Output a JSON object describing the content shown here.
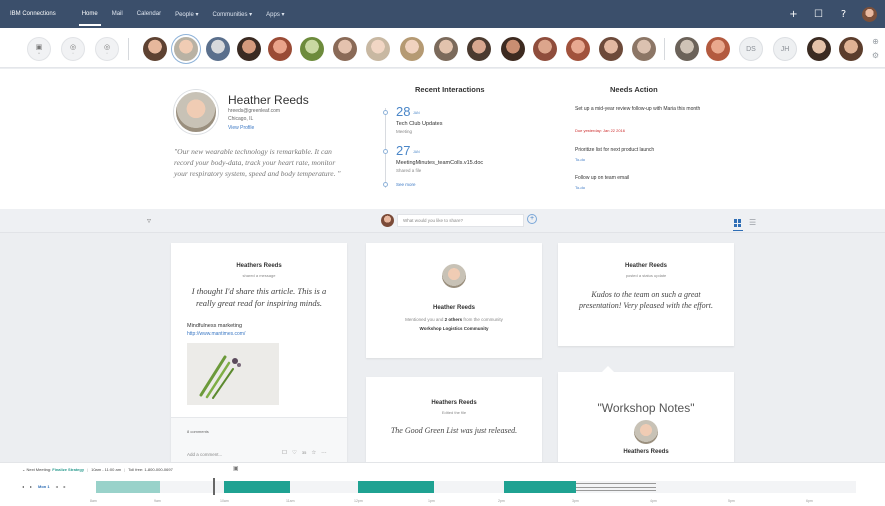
{
  "topnav": {
    "brand": "IBM Connections",
    "items": [
      "Home",
      "Mail",
      "Calendar",
      "People ▾",
      "Communities ▾",
      "Apps ▾"
    ],
    "active": "Home"
  },
  "strip": {
    "utility": [
      {
        "icon": "calendar-icon",
        "glyph": "▣",
        "caption": "••"
      },
      {
        "icon": "bell-icon",
        "glyph": "◎",
        "caption": "•"
      },
      {
        "icon": "pin-icon",
        "glyph": "◎",
        "caption": "•"
      }
    ],
    "initials": [
      "DS",
      "JH"
    ]
  },
  "profile": {
    "name": "Heather Reeds",
    "email": "hreeds@greenleaf.com",
    "location": "Chicago, IL",
    "view_profile": "View Profile",
    "quote": "\"Our new wearable technology is remarkable. It can record your body-data, track your heart rate, monitor your respiratory system, speed and body temperature. \""
  },
  "recent": {
    "title": "Recent Interactions",
    "items": [
      {
        "day": "28",
        "month": "JAN",
        "text": "Tech Club Updates",
        "sub": "Meeting"
      },
      {
        "day": "27",
        "month": "JAN",
        "text": "MeetingMinutes_teamColls.v15.doc",
        "sub": "Shared a file"
      }
    ],
    "more": "See more"
  },
  "needs": {
    "title": "Needs Action",
    "items": [
      {
        "text": "Set up a mid-year review follow-up with Maria this month",
        "due": "Due yesterday: Jan 22 2016",
        "link": ""
      },
      {
        "text": "Prioritize list for next product launch",
        "due": "",
        "link": "To-do"
      },
      {
        "text": "Follow up on team email",
        "due": "",
        "link": "To-do"
      }
    ]
  },
  "share": {
    "placeholder": "What would you like to share?",
    "plus": "+"
  },
  "cards": {
    "c1": {
      "name": "Heathers Reeds",
      "action": "shared a message",
      "quote": "I thought I'd share this article. This is a really great read for inspiring minds.",
      "link_title": "Mindfulness marketing",
      "link_url": "http://www.mantimes.com/",
      "comments": "8 comments",
      "add_comment": "Add a comment...",
      "likes": "35"
    },
    "c2": {
      "name": "Heather Reeds",
      "mentioned_pre": "Mentioned you and ",
      "mentioned_bold": "2 others",
      "mentioned_post": " from the community",
      "community": "Workshop Logistics Community"
    },
    "c3": {
      "name": "Heather Reeds",
      "action": "posted a status update",
      "quote": "Kudos to the team on such a great presentation! Very pleased with the effort."
    },
    "c4": {
      "name": "Heathers Reeds",
      "action": "Edited the file",
      "quote": "The Good Green List was just released."
    },
    "c5": {
      "title": "\"Workshop Notes\"",
      "name": "Heathers Reeds"
    }
  },
  "meeting": {
    "label": "Next Meeting: ",
    "title": "Finalize Strategy",
    "time": "10am - 11:00 am",
    "tollfree": "Toll free: 1-800-000-0697",
    "nav": [
      "◂",
      "▸",
      "Mon 1",
      "◂",
      "▸"
    ],
    "ticks": [
      "8am",
      "9am",
      "10am",
      "11am",
      "12pm",
      "1pm",
      "2pm",
      "3pm",
      "4pm",
      "5pm",
      "6pm"
    ]
  },
  "colors": {
    "nav": "#3b4f6b",
    "accent": "#2f6eb5",
    "meeting_teal": "#1fa292",
    "meeting_light": "#99d2ca"
  }
}
